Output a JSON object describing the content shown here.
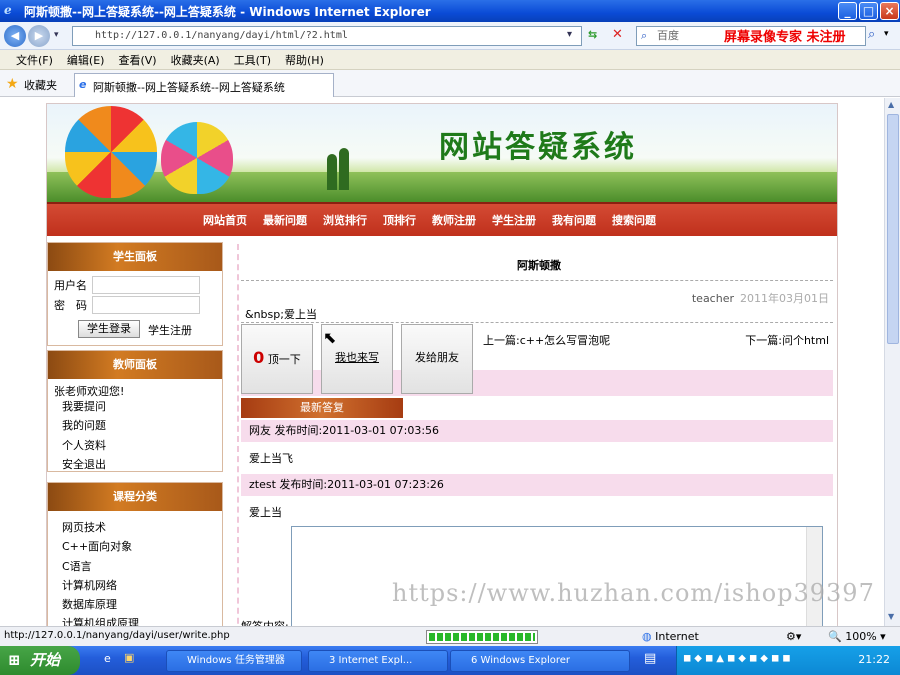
{
  "window": {
    "title": "阿斯顿撒--网上答疑系统--网上答疑系统 - Windows Internet Explorer",
    "minimize": "_",
    "maximize": "□",
    "close": "×"
  },
  "address_bar": {
    "url": "http://127.0.0.1/nanyang/dayi/html/?2.html",
    "search_placeholder": "百度",
    "recorder_text": "屏幕录像专家 未注册"
  },
  "menu": [
    "文件(F)",
    "编辑(E)",
    "查看(V)",
    "收藏夹(A)",
    "工具(T)",
    "帮助(H)"
  ],
  "favorites": {
    "label": "收藏夹",
    "tab_title": "阿斯顿撒--网上答疑系统--网上答疑系统"
  },
  "site": {
    "banner_title": "网站答疑系统",
    "nav": [
      "网站首页",
      "最新问题",
      "浏览排行",
      "顶排行",
      "教师注册",
      "学生注册",
      "我有问题",
      "搜索问题"
    ]
  },
  "student_panel": {
    "title": "学生面板",
    "username_label": "用户名",
    "password_label": "密　码",
    "login_button": "学生登录",
    "register_link": "学生注册"
  },
  "teacher_panel": {
    "title": "教师面板",
    "welcome": "张老师欢迎您!",
    "links": [
      "我要提问",
      "我的问题",
      "个人资料",
      "安全退出"
    ]
  },
  "course_panel": {
    "title": "课程分类",
    "links": [
      "网页技术",
      "C++面向对象",
      "C语言",
      "计算机网络",
      "数据库原理",
      "计算机组成原理"
    ]
  },
  "post": {
    "title": "阿斯顿撒",
    "author": "teacher",
    "date": "2011年03月01日",
    "content": "&nbsp;爱上当",
    "up_count": "0",
    "up_label": "顶一下",
    "write_label": "我也来写",
    "share_label": "发给朋友",
    "prev": "上一篇:c++怎么写冒泡呢",
    "next": "下一篇:问个html"
  },
  "replies_section": {
    "title": "最新答复",
    "replies": [
      {
        "header": "网友  发布时间:2011-03-01 07:03:56",
        "text": "爱上当飞"
      },
      {
        "header": "ztest  发布时间:2011-03-01 07:23:26",
        "text": "爱上当"
      }
    ],
    "answer_label": "解答内容:"
  },
  "watermark": "https://www.huzhan.com/ishop39397",
  "status_bar": {
    "url": "http://127.0.0.1/nanyang/dayi/user/write.php",
    "zone": "Internet",
    "zoom": "100%",
    "progress": 1.0
  },
  "taskbar": {
    "start": "开始",
    "tasks": [
      "Windows 任务管理器",
      "3 Internet Expl...",
      "6 Windows Explorer"
    ],
    "clock": "21:22"
  },
  "colors": {
    "nav_red": "#c0301c",
    "panel_orange": "#d27b22",
    "reply_pink": "#f7dcec",
    "banner_title_green": "#1f7a1a"
  }
}
